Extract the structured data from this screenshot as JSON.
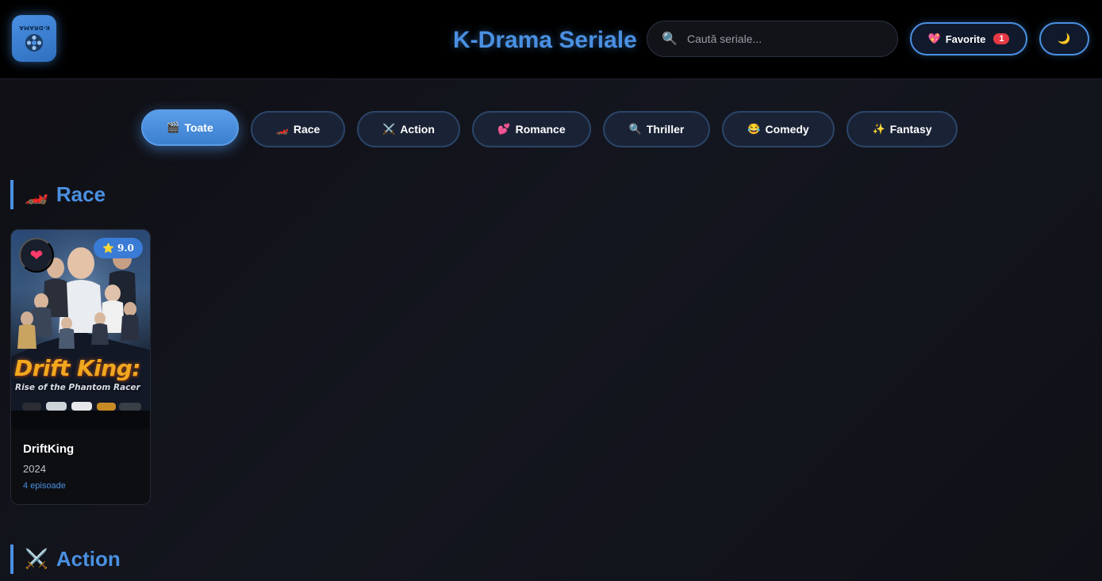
{
  "header": {
    "logo_text": "K-DRAMA",
    "title": "K-Drama Seriale",
    "search_placeholder": "Caută seriale...",
    "favorites_label": "Favorite",
    "favorites_count": "1",
    "theme_icon": "🌙"
  },
  "categories": [
    {
      "emoji": "🎬",
      "label": "Toate",
      "active": true
    },
    {
      "emoji": "🏎️",
      "label": "Race",
      "active": false
    },
    {
      "emoji": "⚔️",
      "label": "Action",
      "active": false
    },
    {
      "emoji": "💕",
      "label": "Romance",
      "active": false
    },
    {
      "emoji": "🔍",
      "label": "Thriller",
      "active": false
    },
    {
      "emoji": "😂",
      "label": "Comedy",
      "active": false
    },
    {
      "emoji": "✨",
      "label": "Fantasy",
      "active": false
    }
  ],
  "sections": [
    {
      "emoji": "🏎️",
      "title": "Race",
      "cards": [
        {
          "poster_title": "Drift King:",
          "poster_subtitle": "Rise of the Phantom Racer",
          "rating": "9.0",
          "name": "DriftKing",
          "year": "2024",
          "episodes": "4 episoade",
          "favorited": true
        }
      ]
    },
    {
      "emoji": "⚔️",
      "title": "Action",
      "cards": []
    }
  ],
  "colors": {
    "accent": "#4a90e2",
    "background": "#0f0f14",
    "badge": "#e53945",
    "poster_title": "#f0a81f"
  }
}
